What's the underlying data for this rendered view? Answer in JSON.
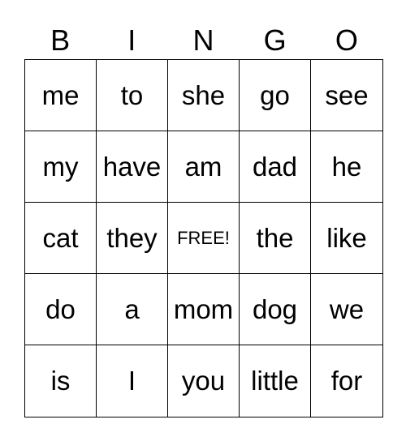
{
  "header": [
    "B",
    "I",
    "N",
    "G",
    "O"
  ],
  "cells": [
    [
      "me",
      "to",
      "she",
      "go",
      "see"
    ],
    [
      "my",
      "have",
      "am",
      "dad",
      "he"
    ],
    [
      "cat",
      "they",
      "FREE!",
      "the",
      "like"
    ],
    [
      "do",
      "a",
      "mom",
      "dog",
      "we"
    ],
    [
      "is",
      "I",
      "you",
      "little",
      "for"
    ]
  ]
}
